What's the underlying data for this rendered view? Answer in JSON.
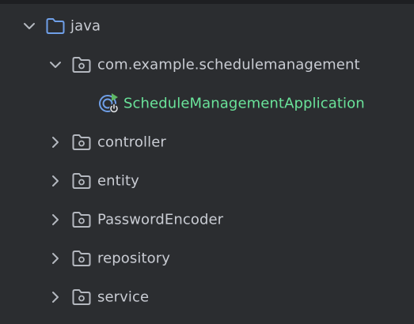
{
  "tree": {
    "root": {
      "label": "java",
      "icon": "folder-icon",
      "expanded": true
    },
    "package": {
      "label": "com.example.schedulemanagement",
      "icon": "package-folder-icon",
      "expanded": true
    },
    "app": {
      "label": "ScheduleManagementApplication",
      "icon": "spring-boot-run-icon"
    },
    "children": [
      {
        "label": "controller",
        "icon": "package-folder-icon",
        "expanded": false
      },
      {
        "label": "entity",
        "icon": "package-folder-icon",
        "expanded": false
      },
      {
        "label": "PasswordEncoder",
        "icon": "package-folder-icon",
        "expanded": false
      },
      {
        "label": "repository",
        "icon": "package-folder-icon",
        "expanded": false
      },
      {
        "label": "service",
        "icon": "package-folder-icon",
        "expanded": false
      }
    ]
  },
  "colors": {
    "background": "#2b2d30",
    "text": "#c9ccd3",
    "app_text": "#6ae39a",
    "root_folder_icon": "#6f9fe8",
    "package_folder_icon": "#b4b8bf"
  }
}
